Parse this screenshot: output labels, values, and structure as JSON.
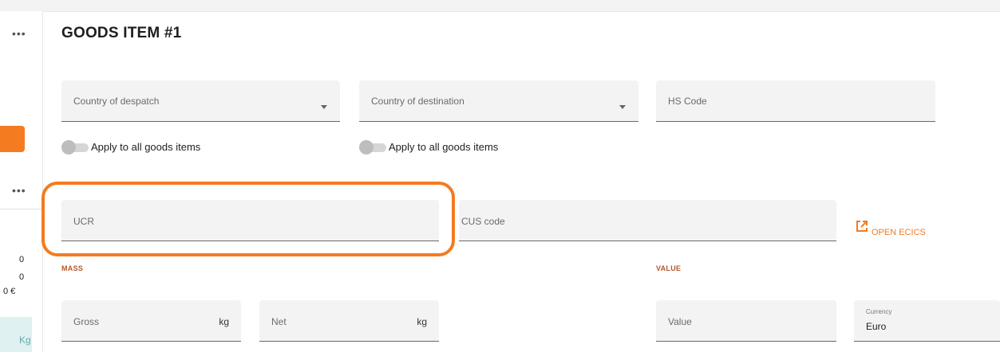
{
  "title": "GOODS ITEM #1",
  "sidebar": {
    "menu_icon_1": "•••",
    "menu_icon_2": "•••",
    "values": [
      "0",
      "0",
      "0 €"
    ],
    "unit": "Kg"
  },
  "fields": {
    "country_despatch": {
      "placeholder": "Country of despatch"
    },
    "country_destination": {
      "placeholder": "Country of destination"
    },
    "hs_code": {
      "placeholder": "HS Code"
    },
    "ucr": {
      "placeholder": "UCR"
    },
    "cus_code": {
      "placeholder": "CUS code"
    },
    "gross": {
      "placeholder": "Gross",
      "unit": "kg"
    },
    "net": {
      "placeholder": "Net",
      "unit": "kg"
    },
    "value": {
      "placeholder": "Value"
    },
    "currency": {
      "label": "Currency",
      "value": "Euro"
    }
  },
  "toggles": {
    "apply_despatch": {
      "label": "Apply to all goods items",
      "on": false
    },
    "apply_destination": {
      "label": "Apply to all goods items",
      "on": false
    }
  },
  "sections": {
    "mass": "MASS",
    "value": "VALUE"
  },
  "ecics": {
    "label": "OPEN ECICS"
  },
  "colors": {
    "accent": "#f47b20",
    "section_label": "#b5582a"
  }
}
